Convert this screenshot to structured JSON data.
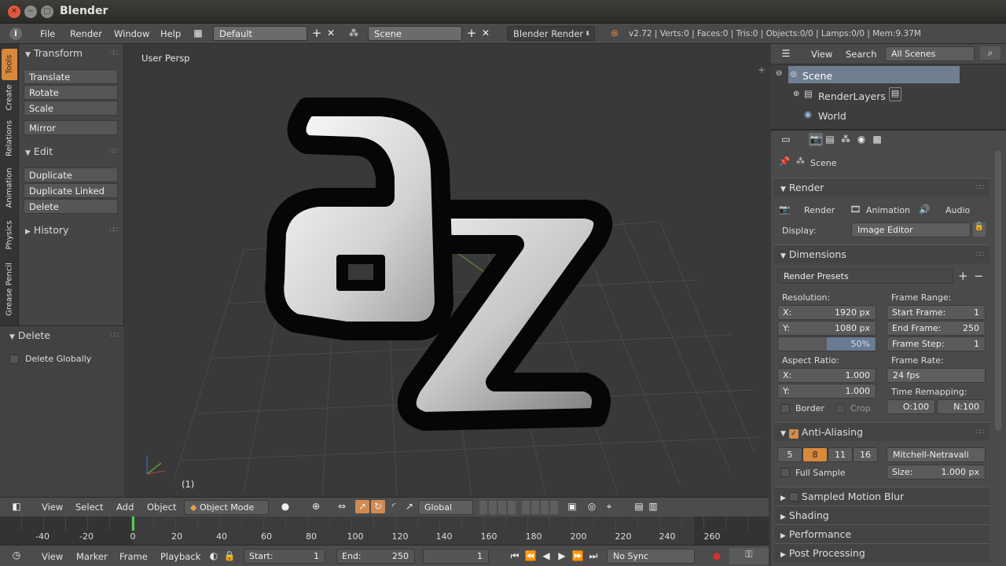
{
  "window": {
    "title": "Blender"
  },
  "menubar": {
    "items": [
      "File",
      "Render",
      "Window",
      "Help"
    ],
    "screen_layout": "Default",
    "scene": "Scene",
    "engine": "Blender Render",
    "stats": "v2.72 | Verts:0 | Faces:0 | Tris:0 | Objects:0/0 | Lamps:0/0 | Mem:9.37M"
  },
  "tool_tabs": [
    "Tools",
    "Create",
    "Relations",
    "Animation",
    "Physics",
    "Grease Pencil"
  ],
  "tool_shelf": {
    "transform": {
      "title": "Transform",
      "buttons": [
        "Translate",
        "Rotate",
        "Scale",
        "Mirror"
      ]
    },
    "edit": {
      "title": "Edit",
      "buttons": [
        "Duplicate",
        "Duplicate Linked",
        "Delete"
      ]
    },
    "history": {
      "title": "History"
    },
    "operator": {
      "title": "Delete",
      "option": "Delete Globally"
    }
  },
  "viewport": {
    "view_name": "User Persp",
    "frame_label": "(1)"
  },
  "viewport_header": {
    "menus": [
      "View",
      "Select",
      "Add",
      "Object"
    ],
    "mode": "Object Mode",
    "orientation": "Global"
  },
  "timeline": {
    "ticks": [
      "-40",
      "-20",
      "0",
      "20",
      "40",
      "60",
      "80",
      "100",
      "120",
      "140",
      "160",
      "180",
      "200",
      "220",
      "240",
      "260"
    ],
    "menus": [
      "View",
      "Marker",
      "Frame",
      "Playback"
    ],
    "start_label": "Start:",
    "start_value": "1",
    "end_label": "End:",
    "end_value": "250",
    "current_frame": "1",
    "sync": "No Sync"
  },
  "outliner": {
    "menus": [
      "View",
      "Search"
    ],
    "filter": "All Scenes",
    "items": [
      "Scene",
      "RenderLayers",
      "World"
    ]
  },
  "properties": {
    "context": "Scene",
    "render": {
      "title": "Render",
      "buttons": [
        "Render",
        "Animation",
        "Audio"
      ],
      "display_label": "Display:",
      "display_value": "Image Editor"
    },
    "dimensions": {
      "title": "Dimensions",
      "presets": "Render Presets",
      "resolution_label": "Resolution:",
      "res_x": "1920 px",
      "res_y": "1080 px",
      "res_pct": "50%",
      "frame_range_label": "Frame Range:",
      "start_frame_label": "Start Frame:",
      "start_frame": "1",
      "end_frame_label": "End Frame:",
      "end_frame": "250",
      "frame_step_label": "Frame Step:",
      "frame_step": "1",
      "aspect_label": "Aspect Ratio:",
      "aspect_x": "1.000",
      "aspect_y": "1.000",
      "frame_rate_label": "Frame Rate:",
      "frame_rate": "24 fps",
      "time_remap_label": "Time Remapping:",
      "remap_old": "O:100",
      "remap_new": "N:100",
      "border": "Border",
      "crop": "Crop",
      "x_label": "X:",
      "y_label": "Y:"
    },
    "anti_aliasing": {
      "title": "Anti-Aliasing",
      "samples": [
        "5",
        "8",
        "11",
        "16"
      ],
      "filter": "Mitchell-Netravali",
      "full_sample": "Full Sample",
      "size_label": "Size:",
      "size_value": "1.000 px"
    },
    "collapsed": [
      "Sampled Motion Blur",
      "Shading",
      "Performance",
      "Post Processing"
    ]
  },
  "colors": {
    "accent": "#e08a42",
    "active_tab": "#d9893b"
  }
}
